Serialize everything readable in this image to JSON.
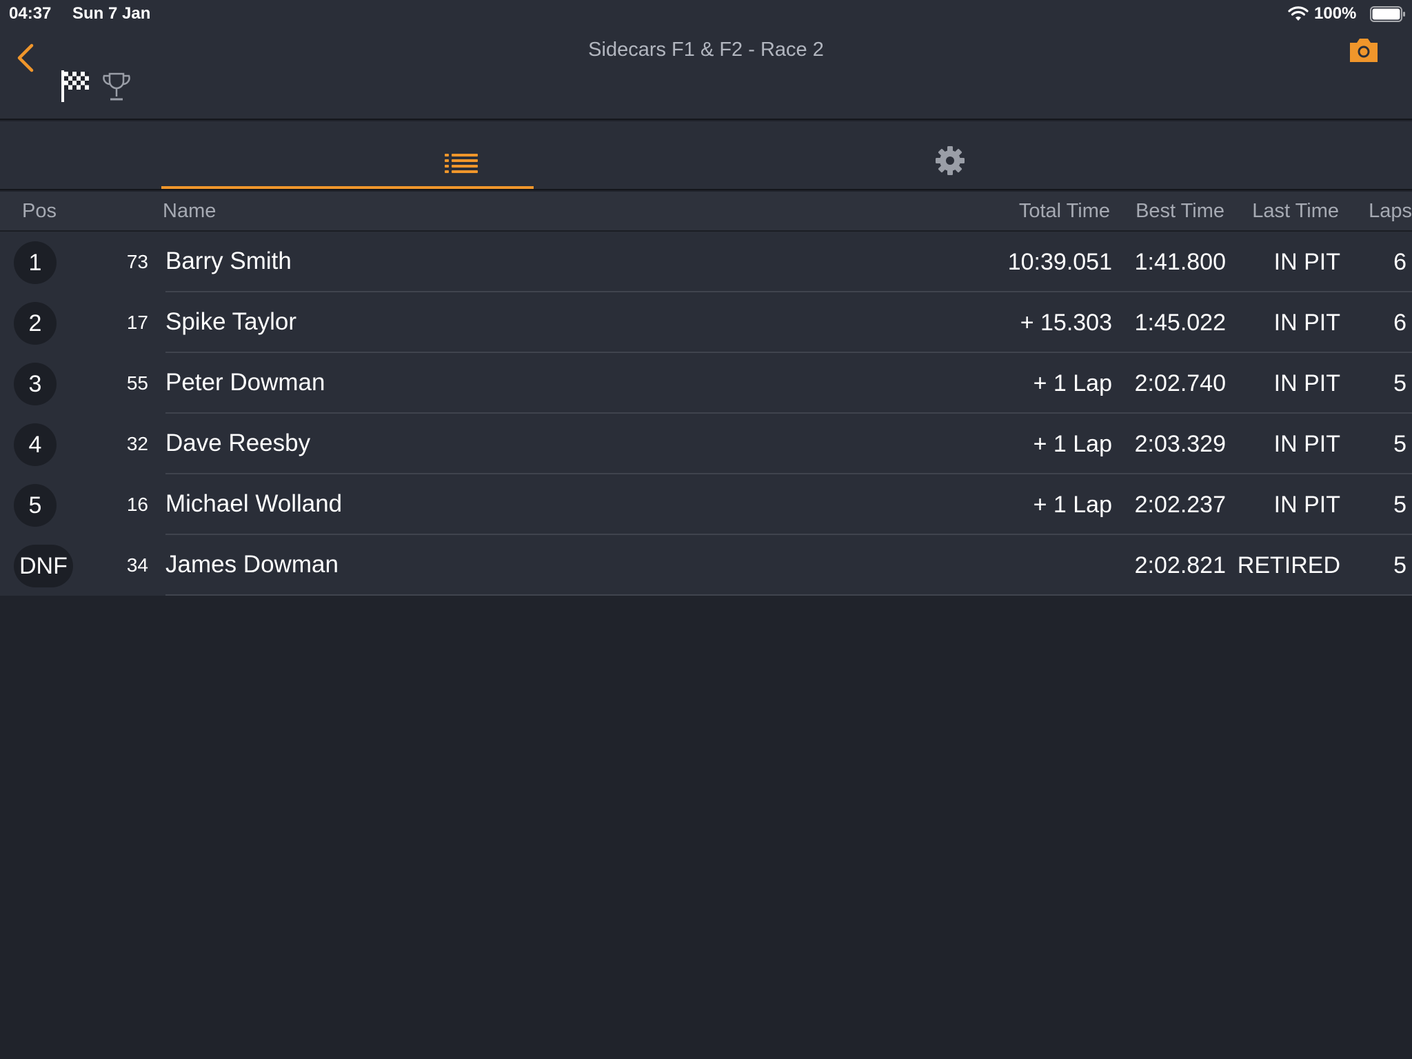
{
  "status_bar": {
    "time": "04:37",
    "date": "Sun 7 Jan",
    "battery": "100%"
  },
  "nav": {
    "title": "Sidecars F1 & F2 - Race 2",
    "back_icon": "chevron-left-icon",
    "camera_icon": "camera-icon",
    "flag_icon": "checkered-flag-icon",
    "trophy_icon": "trophy-icon"
  },
  "tabs": {
    "active": "list",
    "items": [
      {
        "id": "list",
        "icon": "list-icon"
      },
      {
        "id": "settings",
        "icon": "gear-icon"
      }
    ]
  },
  "table": {
    "headers": {
      "pos": "Pos",
      "name": "Name",
      "total": "Total Time",
      "best": "Best Time",
      "last": "Last Time",
      "laps": "Laps"
    },
    "rows": [
      {
        "pos": "1",
        "number": "73",
        "name": "Barry Smith",
        "total": "10:39.051",
        "best": "1:41.800",
        "last": "IN PIT",
        "laps": "6"
      },
      {
        "pos": "2",
        "number": "17",
        "name": "Spike Taylor",
        "total": "+ 15.303",
        "best": "1:45.022",
        "last": "IN PIT",
        "laps": "6"
      },
      {
        "pos": "3",
        "number": "55",
        "name": "Peter Dowman",
        "total": "+ 1 Lap",
        "best": "2:02.740",
        "last": "IN PIT",
        "laps": "5"
      },
      {
        "pos": "4",
        "number": "32",
        "name": "Dave Reesby",
        "total": "+ 1 Lap",
        "best": "2:03.329",
        "last": "IN PIT",
        "laps": "5"
      },
      {
        "pos": "5",
        "number": "16",
        "name": "Michael Wolland",
        "total": "+ 1 Lap",
        "best": "2:02.237",
        "last": "IN PIT",
        "laps": "5"
      },
      {
        "pos": "DNF",
        "number": "34",
        "name": "James Dowman",
        "total": "",
        "best": "2:02.821",
        "last": "RETIRED",
        "laps": "5"
      }
    ]
  },
  "colors": {
    "accent": "#f0962b",
    "background": "#20232b",
    "bar": "#2a2e38"
  }
}
